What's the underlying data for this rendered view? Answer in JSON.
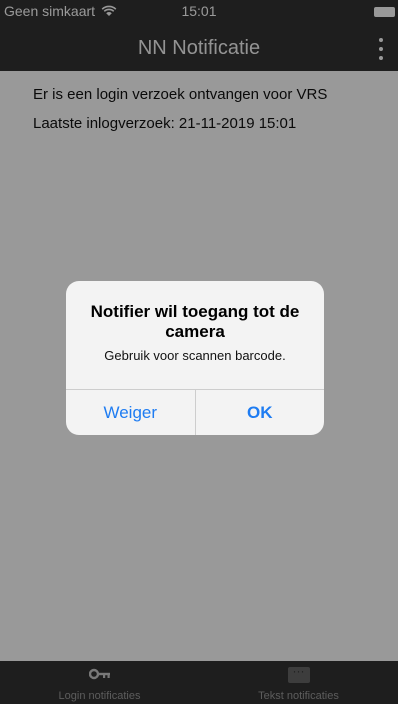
{
  "status_bar": {
    "carrier": "Geen simkaart",
    "time": "15:01"
  },
  "app_bar": {
    "title": "NN Notificatie"
  },
  "content": {
    "line1": "Er is een login verzoek ontvangen voor VRS",
    "line2": "Laatste inlogverzoek: 21-11-2019 15:01"
  },
  "dialog": {
    "title": "Notifier wil toegang tot de camera",
    "message": "Gebruik voor scannen barcode.",
    "deny_label": "Weiger",
    "ok_label": "OK"
  },
  "tab_bar": {
    "tabs": [
      {
        "label": "Login notificaties",
        "icon": "key-icon"
      },
      {
        "label": "Tekst notificaties",
        "icon": "chat-icon"
      }
    ]
  },
  "colors": {
    "bar_background": "#333333",
    "accent": "#1e7cf2",
    "dialog_background": "#f3f3f3"
  }
}
